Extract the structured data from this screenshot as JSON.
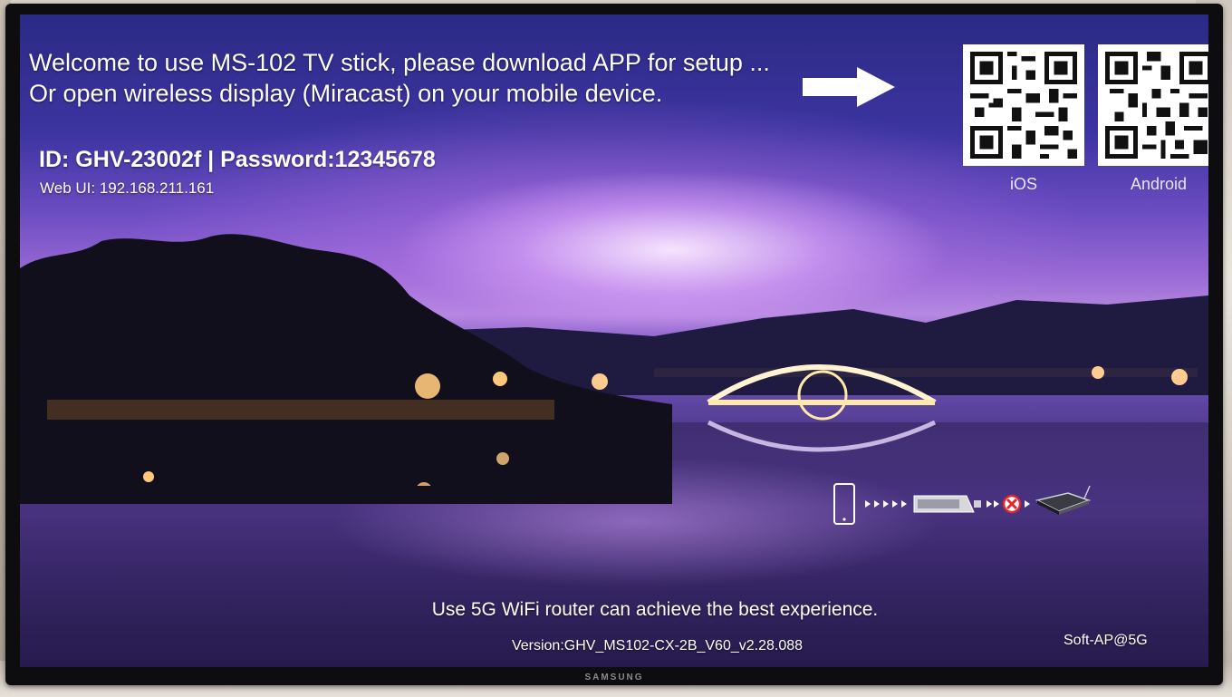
{
  "device": {
    "brand": "SAMSUNG"
  },
  "setup_screen": {
    "welcome_line1": "Welcome to use MS-102 TV stick, please download APP for setup ...",
    "welcome_line2": "Or open wireless display (Miracast) on your mobile device.",
    "credentials": "ID: GHV-23002f | Password:12345678",
    "web_ui": "Web UI: 192.168.211.161",
    "arrow_icon": "right-arrow-icon",
    "qr_codes": [
      {
        "label": "iOS",
        "icon": "qr-code-icon"
      },
      {
        "label": "Android",
        "icon": "qr-code-icon"
      }
    ],
    "connection_diagram": {
      "icons": [
        "smartphone-icon",
        "tv-stick-icon",
        "blocked-icon",
        "router-icon"
      ],
      "arrow_color": "#ffffff",
      "blocked_color": "#e0262e"
    },
    "hint": "Use 5G WiFi router can achieve the best experience.",
    "version": "Version:GHV_MS102-CX-2B_V60_v2.28.088",
    "mode": "Soft-AP@5G"
  },
  "colors": {
    "text": "#ffffff",
    "label": "#e8e6f3",
    "sky_top": "#2b2a85",
    "sky_glow": "#b58ae0"
  }
}
